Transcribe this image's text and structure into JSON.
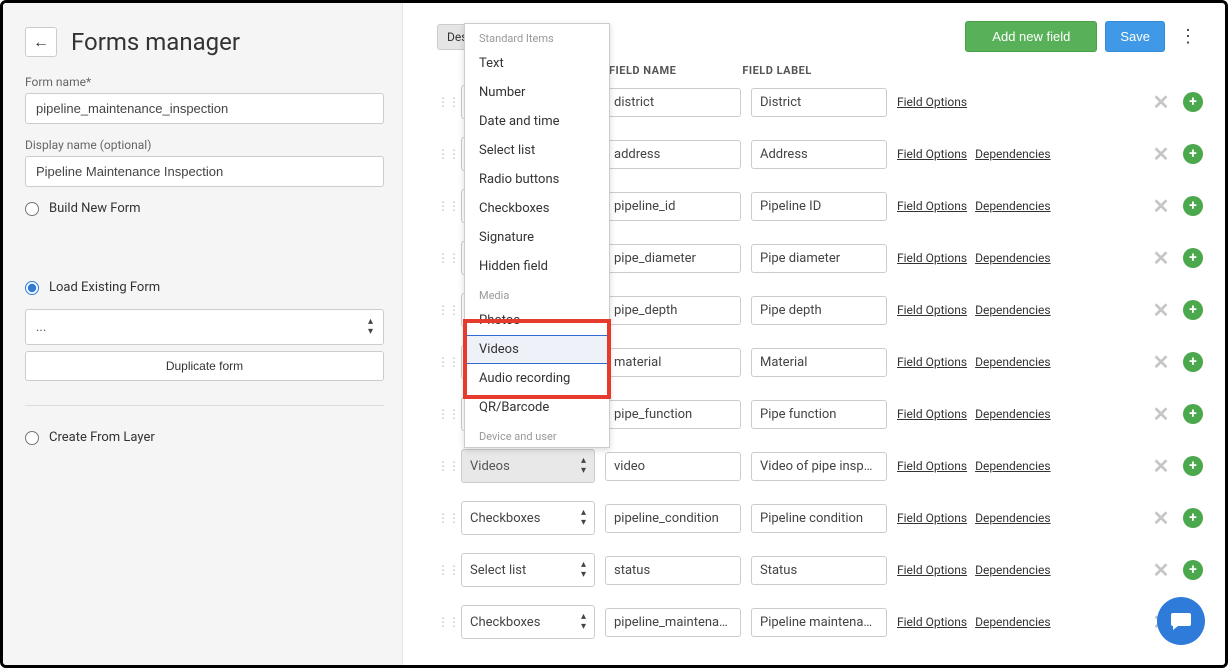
{
  "page": {
    "title": "Forms manager"
  },
  "sidebar": {
    "back_arrow": "←",
    "form_name_label": "Form name*",
    "form_name_value": "pipeline_maintenance_inspection",
    "display_name_label": "Display name (optional)",
    "display_name_value": "Pipeline Maintenance Inspection",
    "radio_build": "Build New Form",
    "radio_load": "Load Existing Form",
    "load_select_value": "...",
    "duplicate_label": "Duplicate form",
    "radio_create_layer": "Create From Layer"
  },
  "topbar": {
    "design_tab": "Desig",
    "add_new_field": "Add new field",
    "save": "Save"
  },
  "columns": {
    "field_name": "FIELD NAME",
    "field_label": "FIELD LABEL"
  },
  "dropdown": {
    "group_standard": "Standard Items",
    "items_standard": [
      "Text",
      "Number",
      "Date and time",
      "Select list",
      "Radio buttons",
      "Checkboxes",
      "Signature",
      "Hidden field"
    ],
    "group_media": "Media",
    "items_media": [
      "Photos",
      "Videos",
      "Audio recording",
      "QR/Barcode"
    ],
    "group_device": "Device and user"
  },
  "row_links": {
    "options": "Field Options",
    "deps": "Dependencies"
  },
  "rows": [
    {
      "type": "",
      "name": "district",
      "label": "District",
      "showDeps": false
    },
    {
      "type": "",
      "name": "address",
      "label": "Address",
      "showDeps": true
    },
    {
      "type": "",
      "name": "pipeline_id",
      "label": "Pipeline ID",
      "showDeps": true
    },
    {
      "type": "",
      "name": "pipe_diameter",
      "label": "Pipe diameter",
      "showDeps": true
    },
    {
      "type": "",
      "name": "pipe_depth",
      "label": "Pipe depth",
      "showDeps": true
    },
    {
      "type": "",
      "name": "material",
      "label": "Material",
      "showDeps": true
    },
    {
      "type": "",
      "name": "pipe_function",
      "label": "Pipe function",
      "showDeps": true
    },
    {
      "type": "Videos",
      "name": "video",
      "label": "Video of pipe inspection",
      "showDeps": true,
      "dim": true
    },
    {
      "type": "Checkboxes",
      "name": "pipeline_condition",
      "label": "Pipeline condition",
      "showDeps": true
    },
    {
      "type": "Select list",
      "name": "status",
      "label": "Status",
      "showDeps": true
    },
    {
      "type": "Checkboxes",
      "name": "pipeline_maintenance_a",
      "label": "Pipeline maintenance a",
      "showDeps": true
    }
  ]
}
